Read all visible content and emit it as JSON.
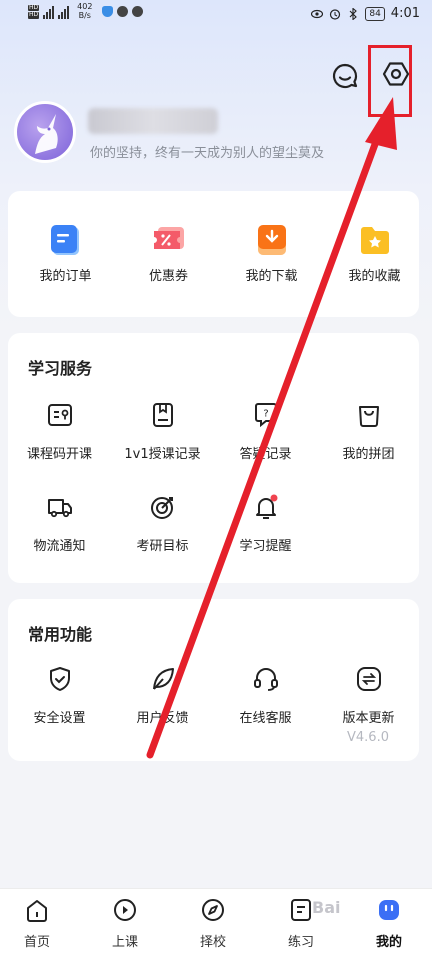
{
  "status_bar": {
    "hd1": "HD",
    "hd2": "HD",
    "net_speed_value": "402",
    "net_speed_unit": "B/s",
    "battery": "84",
    "time": "4:01"
  },
  "profile": {
    "motto": "你的坚持，终有一天成为别人的望尘莫及"
  },
  "top_actions": [
    {
      "label": "我的订单",
      "icon": "order-icon",
      "color": "#3b82f6"
    },
    {
      "label": "优惠券",
      "icon": "coupon-icon",
      "color": "#f45b69"
    },
    {
      "label": "我的下载",
      "icon": "download-icon",
      "color": "#f97316"
    },
    {
      "label": "我的收藏",
      "icon": "favorite-folder-icon",
      "color": "#fbbf24"
    }
  ],
  "study_services": {
    "title": "学习服务",
    "items": [
      {
        "label": "课程码开课",
        "icon": "course-code-icon"
      },
      {
        "label": "1v1授课记录",
        "icon": "tutoring-record-icon"
      },
      {
        "label": "答疑记录",
        "icon": "qa-record-icon"
      },
      {
        "label": "我的拼团",
        "icon": "group-buy-icon"
      },
      {
        "label": "物流通知",
        "icon": "delivery-truck-icon"
      },
      {
        "label": "考研目标",
        "icon": "target-icon"
      },
      {
        "label": "学习提醒",
        "icon": "bell-icon"
      }
    ]
  },
  "common_functions": {
    "title": "常用功能",
    "items": [
      {
        "label": "安全设置",
        "icon": "shield-icon"
      },
      {
        "label": "用户反馈",
        "icon": "feedback-leaf-icon"
      },
      {
        "label": "在线客服",
        "icon": "headset-icon"
      },
      {
        "label": "版本更新",
        "icon": "update-icon"
      }
    ],
    "version": "V4.6.0"
  },
  "bottom_nav": [
    {
      "label": "首页",
      "icon": "home-icon",
      "active": false
    },
    {
      "label": "上课",
      "icon": "play-icon",
      "active": false
    },
    {
      "label": "择校",
      "icon": "compass-icon",
      "active": false
    },
    {
      "label": "练习",
      "icon": "practice-icon",
      "active": false
    },
    {
      "label": "我的",
      "icon": "profile-icon",
      "active": true
    }
  ],
  "colors": {
    "accent": "#3b82f6",
    "annotation_red": "#e5202b"
  }
}
